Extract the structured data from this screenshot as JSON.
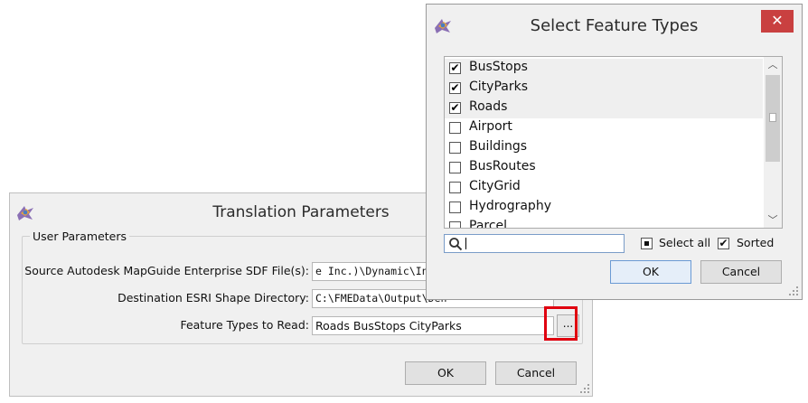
{
  "translation_dialog": {
    "title": "Translation Parameters",
    "group_label": "User Parameters",
    "params": [
      {
        "label": "Source Autodesk MapGuide Enterprise SDF File(s):",
        "value": "e Inc.)\\Dynamic\\Interop"
      },
      {
        "label": "Destination ESRI Shape Directory:",
        "value": "C:\\FMEData\\Output\\Den"
      },
      {
        "label": "Feature Types to Read:",
        "value": "Roads BusStops CityParks"
      }
    ],
    "browse_label": "...",
    "ok_label": "OK",
    "cancel_label": "Cancel",
    "highlight_color": "#e0000f"
  },
  "select_dialog": {
    "title": "Select Feature Types",
    "close_glyph": "✕",
    "items": [
      {
        "label": "BusStops",
        "checked": true
      },
      {
        "label": "CityParks",
        "checked": true
      },
      {
        "label": "Roads",
        "checked": true
      },
      {
        "label": "Airport",
        "checked": false
      },
      {
        "label": "Buildings",
        "checked": false
      },
      {
        "label": "BusRoutes",
        "checked": false
      },
      {
        "label": "CityGrid",
        "checked": false
      },
      {
        "label": "Hydrography",
        "checked": false
      },
      {
        "label": "Parcel",
        "checked": false
      }
    ],
    "search_placeholder": "",
    "select_all_label": "Select all",
    "sorted_label": "Sorted",
    "sorted_checked": true,
    "ok_label": "OK",
    "cancel_label": "Cancel"
  },
  "icons": {
    "app_logo": "fme-workbench-icon",
    "search": "search-icon",
    "close": "close-icon",
    "scroll_up": "chevron-up-icon",
    "scroll_down": "chevron-down-icon",
    "check": "checkmark-icon"
  },
  "colors": {
    "close_button": "#c94040",
    "window_bg": "#f0f0f0",
    "highlight_box": "#e0000f"
  }
}
